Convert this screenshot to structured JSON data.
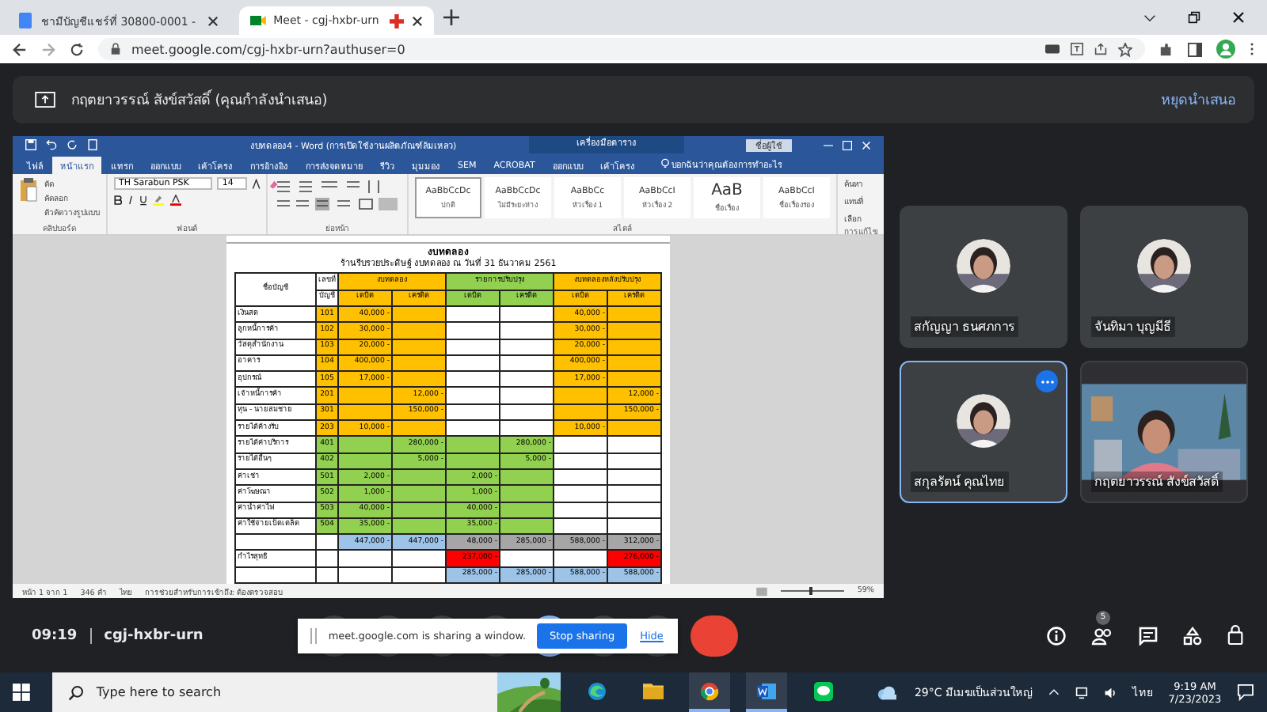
{
  "browser": {
    "tabs": [
      {
        "title": "ชามีบัญชีแชร์ที่ 30800-0001 -",
        "selected": false,
        "recording": false
      },
      {
        "title": "Meet - cgj-hxbr-urn",
        "selected": true,
        "recording": true
      }
    ],
    "url": "meet.google.com/cgj-hxbr-urn?authuser=0"
  },
  "banner": {
    "text": "กฤตยาวรรณ์ สังข์สวัสดิ์ (คุณกำลังนำเสนอ)",
    "action": "หยุดนำเสนอ"
  },
  "word": {
    "title": "งบทดลอง4 - Word (การเปิดใช้งานผลิตภัณฑ์ล้มเหลว)",
    "context": "เครื่องมือตาราง",
    "user": "ชื่อผู้ใช้",
    "tabs": [
      {
        "label": "ไฟล์",
        "selected": false
      },
      {
        "label": "หน้าแรก",
        "selected": true
      },
      {
        "label": "แทรก",
        "selected": false
      },
      {
        "label": "ออกแบบ",
        "selected": false
      },
      {
        "label": "เค้าโครง",
        "selected": false
      },
      {
        "label": "การอ้างอิง",
        "selected": false
      },
      {
        "label": "การส่งจดหมาย",
        "selected": false
      },
      {
        "label": "รีวิว",
        "selected": false
      },
      {
        "label": "มุมมอง",
        "selected": false
      },
      {
        "label": "SEM",
        "selected": false
      },
      {
        "label": "ACROBAT",
        "selected": false
      },
      {
        "label": "ออกแบบ",
        "selected": false
      },
      {
        "label": "เค้าโครง",
        "selected": false
      }
    ],
    "tell_me": "บอกฉันว่าคุณต้องการทำอะไร",
    "font": "TH Sarabun PSK",
    "size": "14",
    "clipboard": [
      "ตัด",
      "คัดลอก",
      "ตัวคัดวางรูปแบบ"
    ],
    "styles": [
      {
        "sample": "AaBbCcDc",
        "name": "ปกติ",
        "selected": true
      },
      {
        "sample": "AaBbCcDc",
        "name": "ไม่มีระยะห่าง",
        "selected": false
      },
      {
        "sample": "AaBbCc",
        "name": "หัวเรื่อง 1",
        "selected": false
      },
      {
        "sample": "AaBbCcI",
        "name": "หัวเรื่อง 2",
        "selected": false
      },
      {
        "sample": "AaB",
        "name": "ชื่อเรื่อง",
        "selected": false
      },
      {
        "sample": "AaBbCcI",
        "name": "ชื่อเรื่องรอง",
        "selected": false
      }
    ],
    "editing": [
      "ค้นหา",
      "แทนที่",
      "เลือก"
    ],
    "groups": [
      "คลิปบอร์ด",
      "ฟอนต์",
      "ย่อหน้า",
      "สไตล์",
      "การแก้ไข"
    ],
    "status": {
      "page": "หน้า 1 จาก 1",
      "words": "346 คำ",
      "language": "ไทย",
      "accessibility": "การช่วยสำหรับการเข้าถึง: ต้องตรวจสอบ",
      "zoom": "59%",
      "level": 0.45
    }
  },
  "document": {
    "title": "งบทดลอง",
    "subtitle": "ร้านรีบรวยประดิษฐ์ งบทดลอง ณ วันที่ 31 ธันวาคม 2561",
    "account_heading": "ชื่อบัญชี",
    "number_heading": [
      "เลขที่",
      "บัญชี"
    ],
    "groups": [
      "งบทดลอง",
      "รายการปรับปรุง",
      "งบทดลองหลังปรับปรุง"
    ],
    "subheads": [
      "เดบิต",
      "เครดิต",
      "เดบิต",
      "เครดิต",
      "เดบิต",
      "เครดิต"
    ],
    "rows": [
      {
        "kind": "asset",
        "name": "เงินสด",
        "no": "101",
        "tb_debit": "40,000 -",
        "post_debit": "40,000 -"
      },
      {
        "kind": "asset",
        "name": "ลูกหนี้การค้า",
        "no": "102",
        "tb_debit": "30,000 -",
        "post_debit": "30,000 -"
      },
      {
        "kind": "asset",
        "name": "วัสดุสำนักงาน",
        "no": "103",
        "tb_debit": "20,000 -",
        "post_debit": "20,000 -"
      },
      {
        "kind": "asset",
        "name": "อาคาร",
        "no": "104",
        "tb_debit": "400,000 -",
        "post_debit": "400,000 -"
      },
      {
        "kind": "asset",
        "name": "อุปกรณ์",
        "no": "105",
        "tb_debit": "17,000 -",
        "post_debit": "17,000 -"
      },
      {
        "kind": "asset",
        "name": "เจ้าหนี้การค้า",
        "no": "201",
        "tb_credit": "12,000 -",
        "post_credit": "12,000 -"
      },
      {
        "kind": "asset",
        "name": "ทุน - นายสมชาย",
        "no": "301",
        "tb_credit": "150,000 -",
        "post_credit": "150,000 -"
      },
      {
        "kind": "asset",
        "name": "รายได้ค้างรับ",
        "no": "203",
        "tb_debit": "10,000 -",
        "post_debit": "10,000 -"
      },
      {
        "kind": "income",
        "name": "รายได้ค่าบริการ",
        "no": "401",
        "tb_credit": "280,000 -",
        "adj_credit": "280,000 -"
      },
      {
        "kind": "income",
        "name": "รายได้อื่นๆ",
        "no": "402",
        "tb_credit": "5,000 -",
        "adj_credit": "5,000 -"
      },
      {
        "kind": "income",
        "name": "ค่าเช่า",
        "no": "501",
        "tb_debit": "2,000 -",
        "adj_debit": "2,000 -"
      },
      {
        "kind": "income",
        "name": "ค่าโฆษณา",
        "no": "502",
        "tb_debit": "1,000 -",
        "adj_debit": "1,000 -"
      },
      {
        "kind": "income",
        "name": "ค่าน้ำค่าไฟ",
        "no": "503",
        "tb_debit": "40,000 -",
        "adj_debit": "40,000 -"
      },
      {
        "kind": "income",
        "name": "ค่าใช้จ่ายเบ็ดเตล็ด",
        "no": "504",
        "tb_debit": "35,000 -",
        "adj_debit": "35,000 -"
      },
      {
        "kind": "total",
        "tb_debit": "447,000 -",
        "tb_credit": "447,000 -",
        "adj_debit": "48,000 -",
        "adj_credit": "285,000 -",
        "post_debit": "588,000 -",
        "post_credit": "312,000 -"
      },
      {
        "kind": "profit",
        "name": "กำไรสุทธิ",
        "adj_debit": "237,000 -",
        "post_credit": "276,000 -"
      },
      {
        "kind": "final",
        "adj_debit": "285,000 -",
        "adj_credit": "285,000 -",
        "post_debit": "588,000 -",
        "post_credit": "588,000 -"
      }
    ]
  },
  "participants": [
    {
      "name": "สกัญญา ธนศภการ",
      "kind": "avatar",
      "selected": false
    },
    {
      "name": "จันทิมา บุญมีธี",
      "kind": "avatar",
      "selected": false
    },
    {
      "name": "สกุลรัตน์ คุณไทย",
      "kind": "avatar",
      "selected": true
    },
    {
      "name": "กฤตยาวรรณ์ สังข์สวัสดิ์",
      "kind": "video",
      "selected": false
    }
  ],
  "meeting": {
    "time": "09:19",
    "code": "cgj-hxbr-urn",
    "people_count": "5"
  },
  "share_notice": {
    "text": "meet.google.com is sharing a window.",
    "stop": "Stop sharing",
    "hide": "Hide"
  },
  "taskbar": {
    "search": "Type here to search",
    "apps": [
      {
        "kind": "edge",
        "active": false
      },
      {
        "kind": "folder",
        "active": false
      },
      {
        "kind": "chrome",
        "active": true
      },
      {
        "kind": "word",
        "active": true
      },
      {
        "kind": "line",
        "active": false
      }
    ],
    "weather": "29°C มีเมฆเป็นส่วนใหญ่",
    "language": "ไทย",
    "time": "9:19 AM",
    "date": "7/23/2023"
  }
}
